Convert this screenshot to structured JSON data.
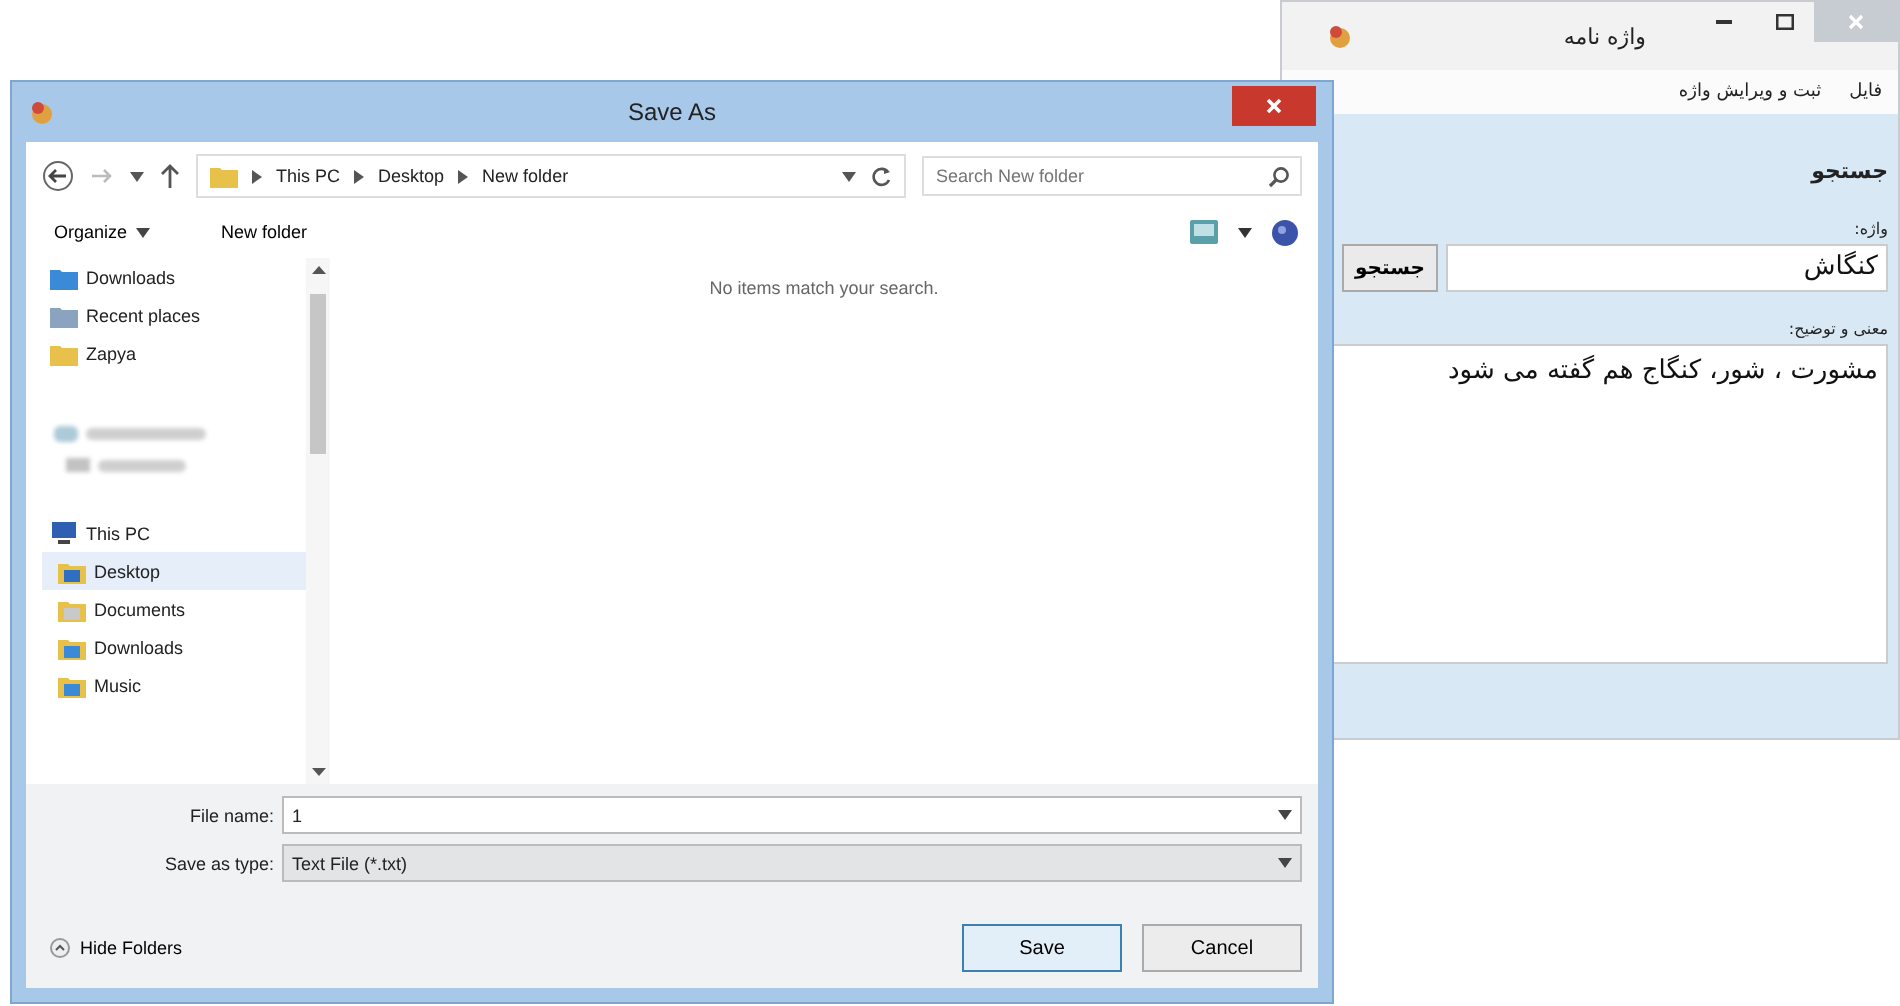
{
  "app_window": {
    "title": "واژه نامه",
    "menu": [
      "فایل",
      "ثبت و ویرایش واژه"
    ],
    "heading": "جستجو",
    "word_label": "واژه:",
    "word_value": "کنگاش",
    "search_button": "جستجو",
    "meaning_label": "معنی و توضیح:",
    "meaning_value": "مشورت ، شور، کنگاج هم گفته می شود"
  },
  "save_dialog": {
    "title": "Save As",
    "breadcrumb": [
      "This PC",
      "Desktop",
      "New folder"
    ],
    "search": {
      "placeholder": "Search New folder"
    },
    "toolbar": [
      {
        "label": "Organize",
        "dropdown": true
      },
      {
        "label": "New folder",
        "dropdown": false
      }
    ],
    "nav_top": [
      {
        "label": "Downloads",
        "kind": "downloads"
      },
      {
        "label": "Recent places",
        "kind": "recent"
      },
      {
        "label": "Zapya",
        "kind": "folder"
      }
    ],
    "nav_pc": {
      "label": "This PC",
      "children": [
        {
          "label": "Desktop",
          "kind": "desktop",
          "selected": true
        },
        {
          "label": "Documents",
          "kind": "documents",
          "selected": false
        },
        {
          "label": "Downloads",
          "kind": "downloads",
          "selected": false
        },
        {
          "label": "Music",
          "kind": "music",
          "selected": false
        }
      ]
    },
    "empty_message": "No items match your search.",
    "file_name": {
      "label": "File name:",
      "value": "1"
    },
    "save_type": {
      "label": "Save as type:",
      "value": "Text File (*.txt)"
    },
    "hide_folders": "Hide Folders",
    "buttons": [
      {
        "label": "Save",
        "default": true
      },
      {
        "label": "Cancel",
        "default": false
      }
    ]
  }
}
